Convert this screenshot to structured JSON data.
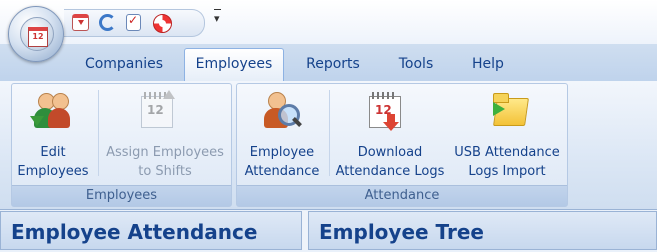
{
  "quick_access": {
    "icons": [
      "calendar-download-icon",
      "refresh-icon",
      "checklist-icon",
      "help-lifebuoy-icon"
    ],
    "app_menu_icon": "calendar-clock-icon",
    "app_menu_badge": "12"
  },
  "tabs": [
    {
      "label": "Companies",
      "active": false
    },
    {
      "label": "Employees",
      "active": true
    },
    {
      "label": "Reports",
      "active": false
    },
    {
      "label": "Tools",
      "active": false
    },
    {
      "label": "Help",
      "active": false
    }
  ],
  "ribbon": {
    "groups": [
      {
        "label": "Employees",
        "buttons": [
          {
            "line1": "Edit",
            "line2": "Employees",
            "enabled": true,
            "icon": "users-edit-icon"
          },
          {
            "line1": "Assign Employees",
            "line2": "to Shifts",
            "enabled": false,
            "icon": "calendar-assign-icon",
            "badge": "12"
          }
        ]
      },
      {
        "label": "Attendance",
        "buttons": [
          {
            "line1": "Employee",
            "line2": "Attendance",
            "enabled": true,
            "icon": "user-search-icon"
          },
          {
            "line1": "Download",
            "line2": "Attendance Logs",
            "enabled": true,
            "icon": "calendar-download-icon",
            "badge": "12"
          },
          {
            "line1": "USB Attendance",
            "line2": "Logs Import",
            "enabled": true,
            "icon": "usb-folder-import-icon"
          }
        ]
      }
    ]
  },
  "panes": {
    "left_title": "Employee Attendance",
    "right_title": "Employee Tree"
  },
  "colors": {
    "accent": "#15428b",
    "ribbon_bg": "#dce7f5",
    "disabled_text": "#8c9bb0"
  }
}
